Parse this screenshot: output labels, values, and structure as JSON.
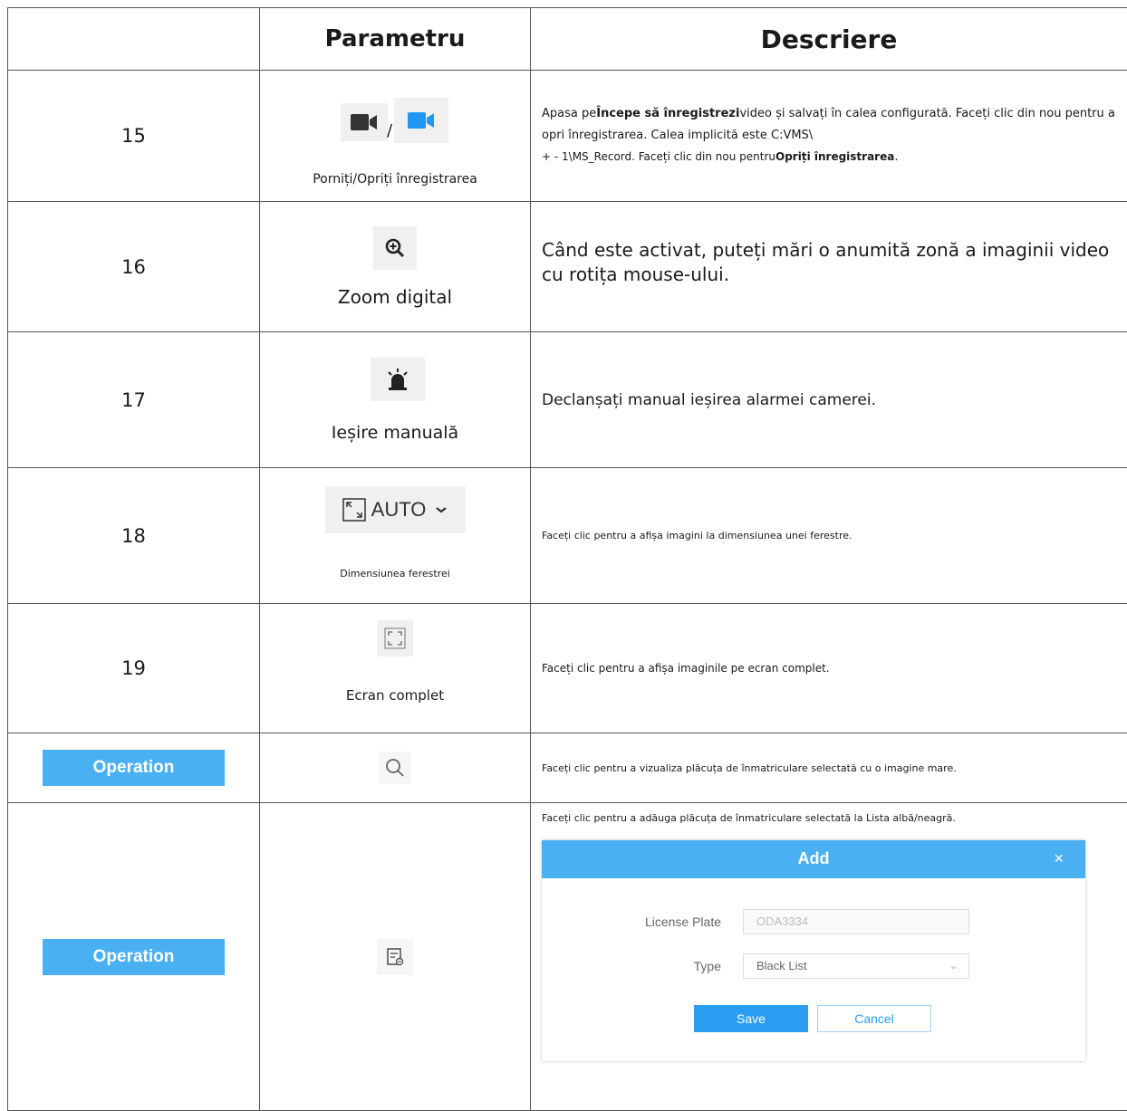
{
  "headers": {
    "col2": "Parametru",
    "col3": "Descriere"
  },
  "rows": [
    {
      "num": "15",
      "sep": "/",
      "label": "Porniți/Opriți înregistrarea",
      "desc": {
        "a": "Apasa pe",
        "b": "Începe să înregistrezi",
        "c": "video și salvați în calea configurată. Faceți clic din nou pentru a opri înregistrarea. Calea implicită este C:VMS\\",
        "d": "+ - 1\\MS_Record. Faceți clic din nou pentru",
        "e": "Opriți înregistrarea",
        "f": "."
      },
      "icons": [
        "camera-dark-icon",
        "camera-blue-icon"
      ]
    },
    {
      "num": "16",
      "label": "Zoom digital",
      "desc": "Când este activat, puteți mări o anumită zonă a imaginii video cu rotița mouse-ului.",
      "icon": "zoom-in-icon"
    },
    {
      "num": "17",
      "label": "Ieșire manuală",
      "desc": "Declanșați manual ieșirea alarmei camerei.",
      "icon": "alarm-siren-icon"
    },
    {
      "num": "18",
      "label": "Dimensiunea ferestrei",
      "desc": "Faceți clic pentru a afișa imagini la dimensiunea unei ferestre.",
      "control_text": "AUTO",
      "icon": "window-size-icon"
    },
    {
      "num": "19",
      "label": "Ecran complet",
      "desc": "Faceți clic pentru a afișa imaginile pe ecran complet.",
      "icon": "fullscreen-icon"
    },
    {
      "button": "Operation",
      "desc": "Faceți clic pentru a vizualiza plăcuța de înmatriculare selectată cu o imagine mare.",
      "icon": "search-icon"
    },
    {
      "button": "Operation",
      "desc": "Faceți clic pentru a adăuga plăcuța de înmatriculare selectată la Lista albă/neagră.",
      "icon": "list-edit-icon"
    }
  ],
  "dialog": {
    "title": "Add",
    "close": "×",
    "license_label": "License Plate",
    "license_value": "ODA3334",
    "type_label": "Type",
    "type_value": "Black List",
    "save": "Save",
    "cancel": "Cancel"
  },
  "colors": {
    "accent": "#4ab0f2",
    "icon_bg": "#f0f0f0",
    "border": "#555555"
  }
}
